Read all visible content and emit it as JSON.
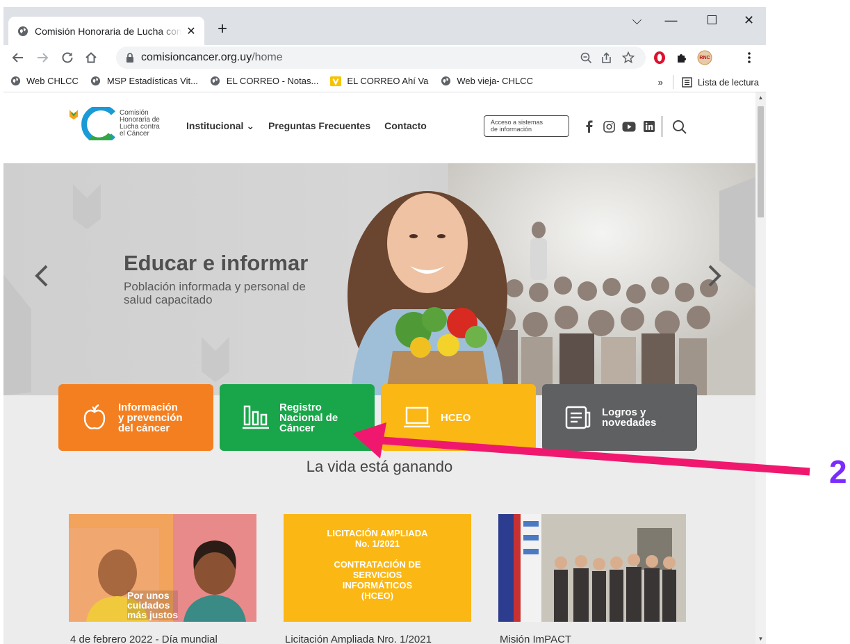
{
  "browser": {
    "tab_title": "Comisión Honoraria de Lucha contra el Cáncer",
    "new_tab": "+",
    "window_controls": {
      "collapse": "⌵",
      "minimize": "—",
      "maximize": "☐",
      "close": "✕"
    },
    "url_host": "comisioncancer.org.uy",
    "url_path": "/home",
    "extension_badge": "RNC",
    "bookmarks": [
      {
        "label": "Web CHLCC",
        "icon": "globe-icon"
      },
      {
        "label": "MSP Estadísticas Vit...",
        "icon": "globe-icon"
      },
      {
        "label": "EL CORREO - Notas...",
        "icon": "globe-icon"
      },
      {
        "label": "EL CORREO Ahí Va",
        "icon": "yellow-v-icon"
      },
      {
        "label": "Web vieja- CHLCC",
        "icon": "globe-icon"
      }
    ],
    "bookmarks_overflow": "»",
    "reading_list": "Lista de lectura"
  },
  "site": {
    "logo_lines": [
      "Comisión",
      "Honoraria de",
      "Lucha contra",
      "el Cáncer"
    ],
    "nav": [
      "Institucional ⌄",
      "Preguntas Frecuentes",
      "Contacto"
    ],
    "access_button": [
      "Acceso a sistemas",
      "de información"
    ],
    "hero": {
      "title": "Educar e informar",
      "subtitle": "Población informada y personal de salud capacitado"
    },
    "cards": [
      {
        "label_lines": [
          "Información",
          "y prevención",
          "del cáncer"
        ],
        "color": "#f47f20",
        "icon": "apple-icon"
      },
      {
        "label_lines": [
          "Registro",
          "Nacional de",
          "Cáncer"
        ],
        "color": "#19a64a",
        "icon": "bar-chart-icon"
      },
      {
        "label_lines": [
          "HCEO"
        ],
        "color": "#fbb713",
        "icon": "laptop-icon"
      },
      {
        "label_lines": [
          "Logros y",
          "novedades"
        ],
        "color": "#5f6062",
        "icon": "news-icon"
      }
    ],
    "section_title": "La vida está ganando",
    "news": [
      {
        "caption": "4 de febrero 2022 - Día mundial",
        "image_text": [
          "Por unos",
          "cuidados",
          "más justos"
        ]
      },
      {
        "caption": "Licitación Ampliada Nro. 1/2021",
        "image_text": [
          "LICITACIÓN AMPLIADA",
          "No. 1/2021",
          "",
          "CONTRATACIÓN DE",
          "SERVICIOS",
          "INFORMÁTICOS",
          "(HCEO)"
        ]
      },
      {
        "caption": "Misión ImPACT",
        "image_text": []
      }
    ]
  },
  "annotation": {
    "number": "2",
    "arrow_color": "#f0186e",
    "number_color": "#7a2bff"
  }
}
